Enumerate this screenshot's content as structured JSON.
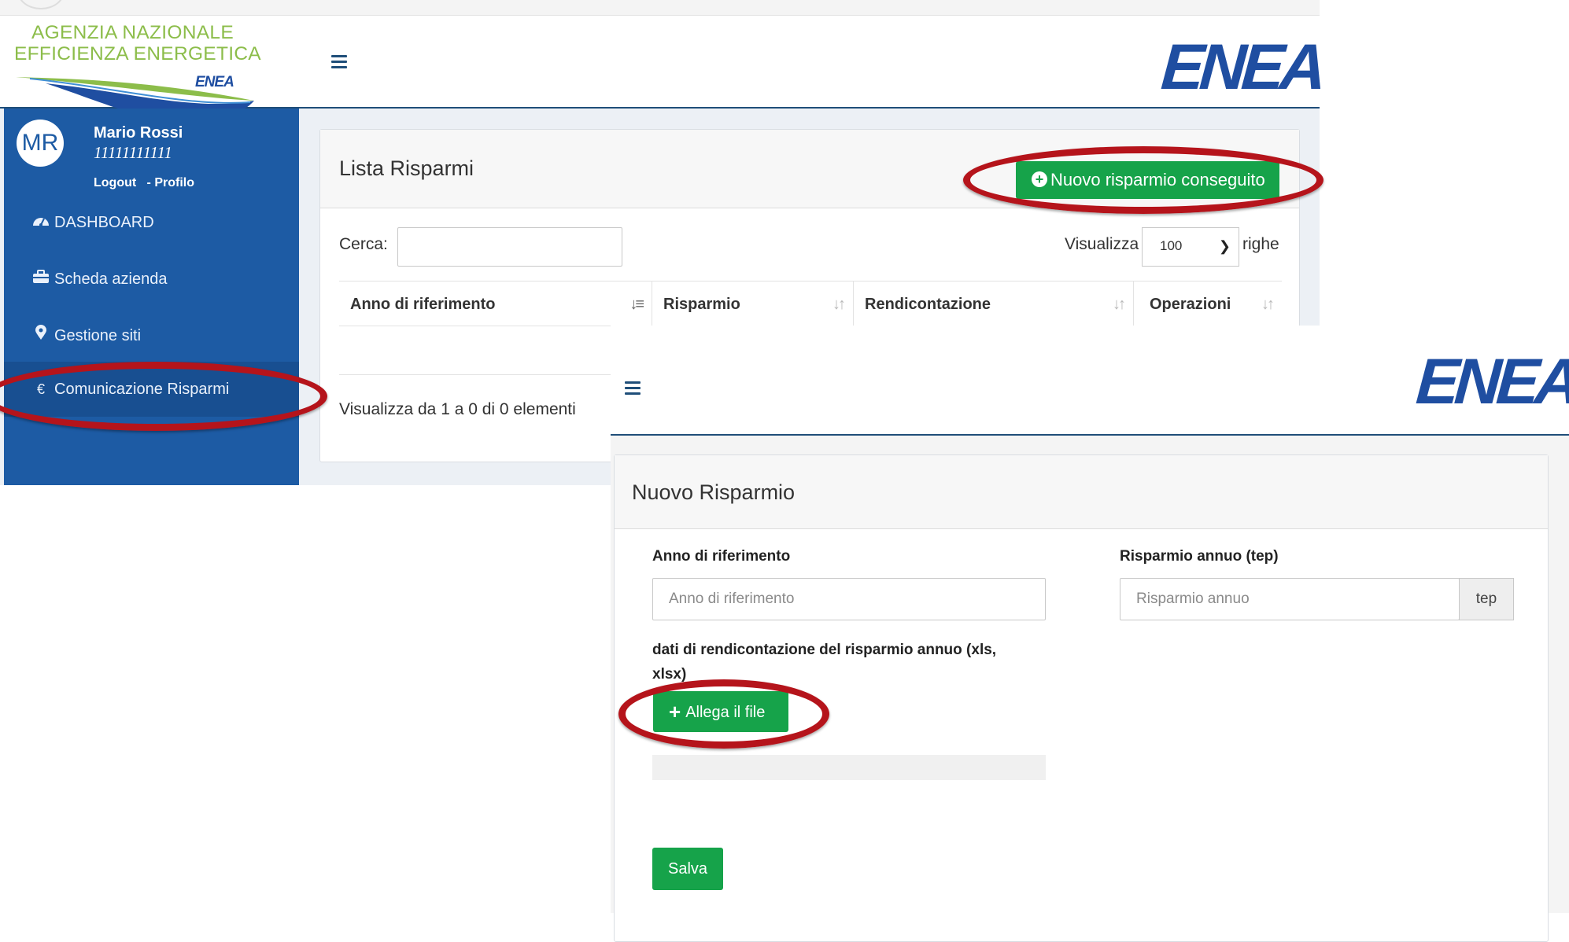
{
  "screen1": {
    "logo": {
      "line1": "AGENZIA NAZIONALE",
      "line2": "EFFICIENZA ENERGETICA",
      "mini_brand": "ENEA",
      "brand": "ENEA"
    },
    "user": {
      "initials": "MR",
      "name": "Mario Rossi",
      "code": "11111111111",
      "logout_label": "Logout",
      "profile_label": "- Profilo"
    },
    "nav": [
      {
        "label": "DASHBOARD",
        "icon": "dashboard-icon"
      },
      {
        "label": "Scheda azienda",
        "icon": "briefcase-icon"
      },
      {
        "label": "Gestione siti",
        "icon": "map-marker-icon"
      },
      {
        "label": "Comunicazione Risparmi",
        "icon": "euro-icon",
        "active": true
      }
    ],
    "panel": {
      "title": "Lista Risparmi",
      "new_button": "Nuovo risparmio conseguito",
      "search_label": "Cerca:",
      "show_label": "Visualizza",
      "show_value": "100",
      "rows_label": "righe",
      "columns": [
        "Anno di riferimento",
        "Risparmio",
        "Rendicontazione",
        "Operazioni"
      ],
      "info": "Visualizza da 1 a 0 di 0 elementi"
    }
  },
  "screen2": {
    "brand": "ENEA",
    "panel": {
      "title": "Nuovo Risparmio",
      "year_label": "Anno di riferimento",
      "year_placeholder": "Anno di riferimento",
      "saving_label": "Risparmio annuo (tep)",
      "saving_placeholder": "Risparmio annuo",
      "saving_unit": "tep",
      "file_label_line1": "dati di rendicontazione del risparmio annuo (xls,",
      "file_label_line2": "xlsx)",
      "attach_button": "Allega il file",
      "save_button": "Salva"
    }
  },
  "colors": {
    "sidebar": "#1d5ba4",
    "brand_blue": "#1f4ea1",
    "accent_green": "#16a34a",
    "logo_green": "#8cbd4a",
    "highlight_red": "#b5141b"
  }
}
